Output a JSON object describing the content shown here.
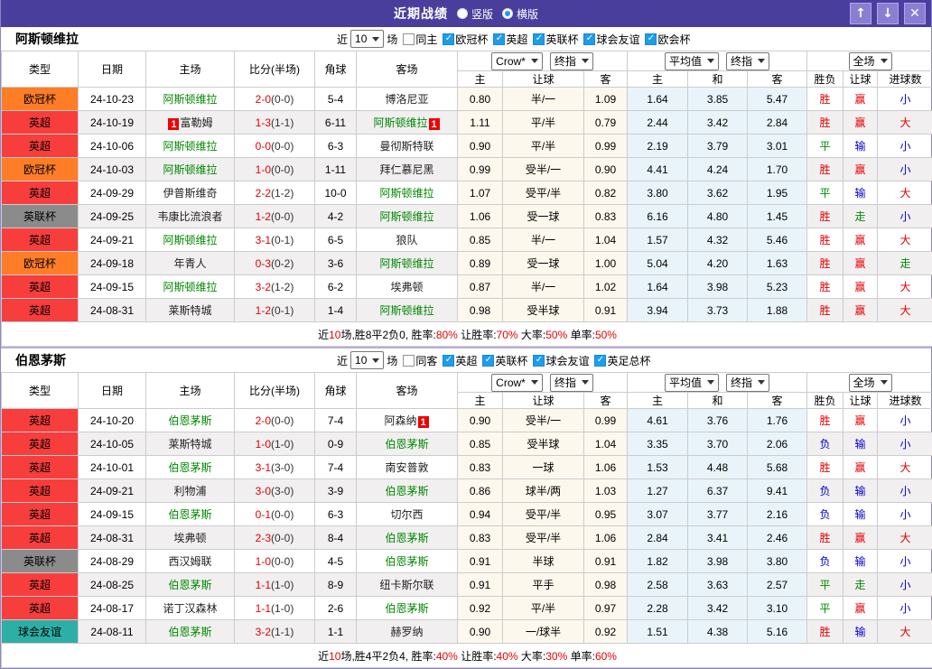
{
  "titlebar": {
    "title": "近期战绩",
    "vertical": "竖版",
    "horizontal": "横版",
    "selected_layout": "横版"
  },
  "icons": {
    "up": "↑",
    "down": "↓",
    "close": "✕",
    "check": "✓",
    "caret": "▾"
  },
  "colors": {
    "titlebar_bg": "#4a3e9d",
    "titlebar_button_bg": "#8a7ed2",
    "checkbox_checked": "#1e9cee",
    "focus_team": "#008800",
    "score": "#e60000",
    "crow_col_bg": "#fdf8ee",
    "avg_col_bg": "#e9f4fa",
    "even_row_bg": "#f1eff0",
    "league": {
      "欧冠杯": "#ff7d27",
      "英超": "#f83d3d",
      "英联杯": "#8b8b8b",
      "球会友谊": "#2eafa5"
    },
    "outcome": {
      "胜": "#e60000",
      "平": "#008800",
      "负": "#0000cc",
      "赢": "#e60000",
      "输": "#0000cc",
      "走": "#008800",
      "大": "#e60000",
      "小": "#0000cc"
    }
  },
  "table_header": {
    "type": "类型",
    "date": "日期",
    "home": "主场",
    "score": "比分(半场)",
    "corner": "角球",
    "away": "客场",
    "odds_group": {
      "book": "Crow*",
      "final": "终指",
      "cols": [
        "主",
        "让球",
        "客"
      ]
    },
    "avg_group": {
      "book": "平均值",
      "final": "终指",
      "cols": [
        "主",
        "和",
        "客"
      ]
    },
    "scope_group": {
      "scope": "全场",
      "cols": [
        "胜负",
        "让球",
        "进球数"
      ]
    }
  },
  "sections": [
    {
      "team": "阿斯顿维拉",
      "filters": {
        "near": "近",
        "count": "10",
        "unit": "场",
        "same": "同主",
        "same_checked": false,
        "leagues": [
          {
            "label": "欧冠杯",
            "checked": true
          },
          {
            "label": "英超",
            "checked": true
          },
          {
            "label": "英联杯",
            "checked": true
          },
          {
            "label": "球会友谊",
            "checked": true
          },
          {
            "label": "欧会杯",
            "checked": true
          }
        ]
      },
      "rows": [
        {
          "league": "欧冠杯",
          "date": "24-10-23",
          "home": "阿斯顿维拉",
          "home_focus": true,
          "home_card": "",
          "score": "2-0",
          "half": "(0-0)",
          "corners": "5-4",
          "away": "博洛尼亚",
          "away_focus": false,
          "away_card": "",
          "odds": [
            "0.80",
            "半/一",
            "1.09"
          ],
          "avg": [
            "1.64",
            "3.85",
            "5.47"
          ],
          "outcome": "胜",
          "handicap": "赢",
          "goals": "小"
        },
        {
          "league": "英超",
          "date": "24-10-19",
          "home": "富勒姆",
          "home_focus": false,
          "home_card": "1",
          "score": "1-3",
          "half": "(1-1)",
          "corners": "6-11",
          "away": "阿斯顿维拉",
          "away_focus": true,
          "away_card": "1",
          "odds": [
            "1.11",
            "平/半",
            "0.79"
          ],
          "avg": [
            "2.44",
            "3.42",
            "2.84"
          ],
          "outcome": "胜",
          "handicap": "赢",
          "goals": "大"
        },
        {
          "league": "英超",
          "date": "24-10-06",
          "home": "阿斯顿维拉",
          "home_focus": true,
          "home_card": "",
          "score": "0-0",
          "half": "(0-0)",
          "corners": "6-3",
          "away": "曼彻斯特联",
          "away_focus": false,
          "away_card": "",
          "odds": [
            "0.90",
            "平/半",
            "0.99"
          ],
          "avg": [
            "2.19",
            "3.79",
            "3.01"
          ],
          "outcome": "平",
          "handicap": "输",
          "goals": "小"
        },
        {
          "league": "欧冠杯",
          "date": "24-10-03",
          "home": "阿斯顿维拉",
          "home_focus": true,
          "home_card": "",
          "score": "1-0",
          "half": "(0-0)",
          "corners": "1-11",
          "away": "拜仁慕尼黑",
          "away_focus": false,
          "away_card": "",
          "odds": [
            "0.99",
            "受半/一",
            "0.90"
          ],
          "avg": [
            "4.41",
            "4.24",
            "1.70"
          ],
          "outcome": "胜",
          "handicap": "赢",
          "goals": "小"
        },
        {
          "league": "英超",
          "date": "24-09-29",
          "home": "伊普斯维奇",
          "home_focus": false,
          "home_card": "",
          "score": "2-2",
          "half": "(1-2)",
          "corners": "10-0",
          "away": "阿斯顿维拉",
          "away_focus": true,
          "away_card": "",
          "odds": [
            "1.07",
            "受平/半",
            "0.82"
          ],
          "avg": [
            "3.80",
            "3.62",
            "1.95"
          ],
          "outcome": "平",
          "handicap": "输",
          "goals": "大"
        },
        {
          "league": "英联杯",
          "date": "24-09-25",
          "home": "韦康比流浪者",
          "home_focus": false,
          "home_card": "",
          "score": "1-2",
          "half": "(0-0)",
          "corners": "4-2",
          "away": "阿斯顿维拉",
          "away_focus": true,
          "away_card": "",
          "odds": [
            "1.06",
            "受一球",
            "0.83"
          ],
          "avg": [
            "6.16",
            "4.80",
            "1.45"
          ],
          "outcome": "胜",
          "handicap": "走",
          "goals": "小"
        },
        {
          "league": "英超",
          "date": "24-09-21",
          "home": "阿斯顿维拉",
          "home_focus": true,
          "home_card": "",
          "score": "3-1",
          "half": "(0-1)",
          "corners": "6-5",
          "away": "狼队",
          "away_focus": false,
          "away_card": "",
          "odds": [
            "0.85",
            "半/一",
            "1.04"
          ],
          "avg": [
            "1.57",
            "4.32",
            "5.46"
          ],
          "outcome": "胜",
          "handicap": "赢",
          "goals": "大"
        },
        {
          "league": "欧冠杯",
          "date": "24-09-18",
          "home": "年青人",
          "home_focus": false,
          "home_card": "",
          "score": "0-3",
          "half": "(0-2)",
          "corners": "3-6",
          "away": "阿斯顿维拉",
          "away_focus": true,
          "away_card": "",
          "odds": [
            "0.89",
            "受一球",
            "1.00"
          ],
          "avg": [
            "5.04",
            "4.20",
            "1.63"
          ],
          "outcome": "胜",
          "handicap": "赢",
          "goals": "走"
        },
        {
          "league": "英超",
          "date": "24-09-15",
          "home": "阿斯顿维拉",
          "home_focus": true,
          "home_card": "",
          "score": "3-2",
          "half": "(1-2)",
          "corners": "6-2",
          "away": "埃弗顿",
          "away_focus": false,
          "away_card": "",
          "odds": [
            "0.87",
            "半/一",
            "1.02"
          ],
          "avg": [
            "1.64",
            "3.98",
            "5.23"
          ],
          "outcome": "胜",
          "handicap": "赢",
          "goals": "大"
        },
        {
          "league": "英超",
          "date": "24-08-31",
          "home": "莱斯特城",
          "home_focus": false,
          "home_card": "",
          "score": "1-2",
          "half": "(0-1)",
          "corners": "1-4",
          "away": "阿斯顿维拉",
          "away_focus": true,
          "away_card": "",
          "odds": [
            "0.98",
            "受半球",
            "0.91"
          ],
          "avg": [
            "3.94",
            "3.73",
            "1.88"
          ],
          "outcome": "胜",
          "handicap": "赢",
          "goals": "大"
        }
      ],
      "summary": [
        {
          "text": "近",
          "red": false
        },
        {
          "text": "10",
          "red": true
        },
        {
          "text": "场,胜8平2负0, 胜率:",
          "red": false
        },
        {
          "text": "80%",
          "red": true
        },
        {
          "text": " 让胜率:",
          "red": false
        },
        {
          "text": "70%",
          "red": true
        },
        {
          "text": " 大率:",
          "red": false
        },
        {
          "text": "50%",
          "red": true
        },
        {
          "text": " 单率:",
          "red": false
        },
        {
          "text": "50%",
          "red": true
        }
      ]
    },
    {
      "team": "伯恩茅斯",
      "filters": {
        "near": "近",
        "count": "10",
        "unit": "场",
        "same": "同客",
        "same_checked": false,
        "leagues": [
          {
            "label": "英超",
            "checked": true
          },
          {
            "label": "英联杯",
            "checked": true
          },
          {
            "label": "球会友谊",
            "checked": true
          },
          {
            "label": "英足总杯",
            "checked": true
          }
        ]
      },
      "rows": [
        {
          "league": "英超",
          "date": "24-10-20",
          "home": "伯恩茅斯",
          "home_focus": true,
          "home_card": "",
          "score": "2-0",
          "half": "(0-0)",
          "corners": "7-4",
          "away": "阿森纳",
          "away_focus": false,
          "away_card": "1",
          "odds": [
            "0.90",
            "受半/一",
            "0.99"
          ],
          "avg": [
            "4.61",
            "3.76",
            "1.76"
          ],
          "outcome": "胜",
          "handicap": "赢",
          "goals": "小"
        },
        {
          "league": "英超",
          "date": "24-10-05",
          "home": "莱斯特城",
          "home_focus": false,
          "home_card": "",
          "score": "1-0",
          "half": "(1-0)",
          "corners": "0-9",
          "away": "伯恩茅斯",
          "away_focus": true,
          "away_card": "",
          "odds": [
            "0.85",
            "受半球",
            "1.04"
          ],
          "avg": [
            "3.35",
            "3.70",
            "2.06"
          ],
          "outcome": "负",
          "handicap": "输",
          "goals": "小"
        },
        {
          "league": "英超",
          "date": "24-10-01",
          "home": "伯恩茅斯",
          "home_focus": true,
          "home_card": "",
          "score": "3-1",
          "half": "(3-0)",
          "corners": "7-4",
          "away": "南安普敦",
          "away_focus": false,
          "away_card": "",
          "odds": [
            "0.83",
            "一球",
            "1.06"
          ],
          "avg": [
            "1.53",
            "4.48",
            "5.68"
          ],
          "outcome": "胜",
          "handicap": "赢",
          "goals": "大"
        },
        {
          "league": "英超",
          "date": "24-09-21",
          "home": "利物浦",
          "home_focus": false,
          "home_card": "",
          "score": "3-0",
          "half": "(3-0)",
          "corners": "3-9",
          "away": "伯恩茅斯",
          "away_focus": true,
          "away_card": "",
          "odds": [
            "0.86",
            "球半/两",
            "1.03"
          ],
          "avg": [
            "1.27",
            "6.37",
            "9.41"
          ],
          "outcome": "负",
          "handicap": "输",
          "goals": "小"
        },
        {
          "league": "英超",
          "date": "24-09-15",
          "home": "伯恩茅斯",
          "home_focus": true,
          "home_card": "",
          "score": "0-1",
          "half": "(0-0)",
          "corners": "6-3",
          "away": "切尔西",
          "away_focus": false,
          "away_card": "",
          "odds": [
            "0.94",
            "受平/半",
            "0.95"
          ],
          "avg": [
            "3.07",
            "3.77",
            "2.16"
          ],
          "outcome": "负",
          "handicap": "输",
          "goals": "小"
        },
        {
          "league": "英超",
          "date": "24-08-31",
          "home": "埃弗顿",
          "home_focus": false,
          "home_card": "",
          "score": "2-3",
          "half": "(0-0)",
          "corners": "8-4",
          "away": "伯恩茅斯",
          "away_focus": true,
          "away_card": "",
          "odds": [
            "0.83",
            "受平/半",
            "1.06"
          ],
          "avg": [
            "2.84",
            "3.41",
            "2.46"
          ],
          "outcome": "胜",
          "handicap": "赢",
          "goals": "大"
        },
        {
          "league": "英联杯",
          "date": "24-08-29",
          "home": "西汉姆联",
          "home_focus": false,
          "home_card": "",
          "score": "1-0",
          "half": "(0-0)",
          "corners": "4-5",
          "away": "伯恩茅斯",
          "away_focus": true,
          "away_card": "",
          "odds": [
            "0.91",
            "半球",
            "0.91"
          ],
          "avg": [
            "1.82",
            "3.98",
            "3.80"
          ],
          "outcome": "负",
          "handicap": "输",
          "goals": "小"
        },
        {
          "league": "英超",
          "date": "24-08-25",
          "home": "伯恩茅斯",
          "home_focus": true,
          "home_card": "",
          "score": "1-1",
          "half": "(1-0)",
          "corners": "8-9",
          "away": "纽卡斯尔联",
          "away_focus": false,
          "away_card": "",
          "odds": [
            "0.91",
            "平手",
            "0.98"
          ],
          "avg": [
            "2.58",
            "3.63",
            "2.57"
          ],
          "outcome": "平",
          "handicap": "走",
          "goals": "小"
        },
        {
          "league": "英超",
          "date": "24-08-17",
          "home": "诺丁汉森林",
          "home_focus": false,
          "home_card": "",
          "score": "1-1",
          "half": "(1-0)",
          "corners": "2-6",
          "away": "伯恩茅斯",
          "away_focus": true,
          "away_card": "",
          "odds": [
            "0.92",
            "平/半",
            "0.97"
          ],
          "avg": [
            "2.28",
            "3.42",
            "3.10"
          ],
          "outcome": "平",
          "handicap": "赢",
          "goals": "小"
        },
        {
          "league": "球会友谊",
          "date": "24-08-11",
          "home": "伯恩茅斯",
          "home_focus": true,
          "home_card": "",
          "score": "3-2",
          "half": "(1-1)",
          "corners": "1-1",
          "away": "赫罗纳",
          "away_focus": false,
          "away_card": "",
          "odds": [
            "0.90",
            "一/球半",
            "0.92"
          ],
          "avg": [
            "1.51",
            "4.38",
            "5.16"
          ],
          "outcome": "胜",
          "handicap": "输",
          "goals": "大"
        }
      ],
      "summary": [
        {
          "text": "近",
          "red": false
        },
        {
          "text": "10",
          "red": true
        },
        {
          "text": "场,胜4平2负4, 胜率:",
          "red": false
        },
        {
          "text": "40%",
          "red": true
        },
        {
          "text": " 让胜率:",
          "red": false
        },
        {
          "text": "40%",
          "red": true
        },
        {
          "text": " 大率:",
          "red": false
        },
        {
          "text": "30%",
          "red": true
        },
        {
          "text": " 单率:",
          "red": false
        },
        {
          "text": "60%",
          "red": true
        }
      ]
    }
  ]
}
